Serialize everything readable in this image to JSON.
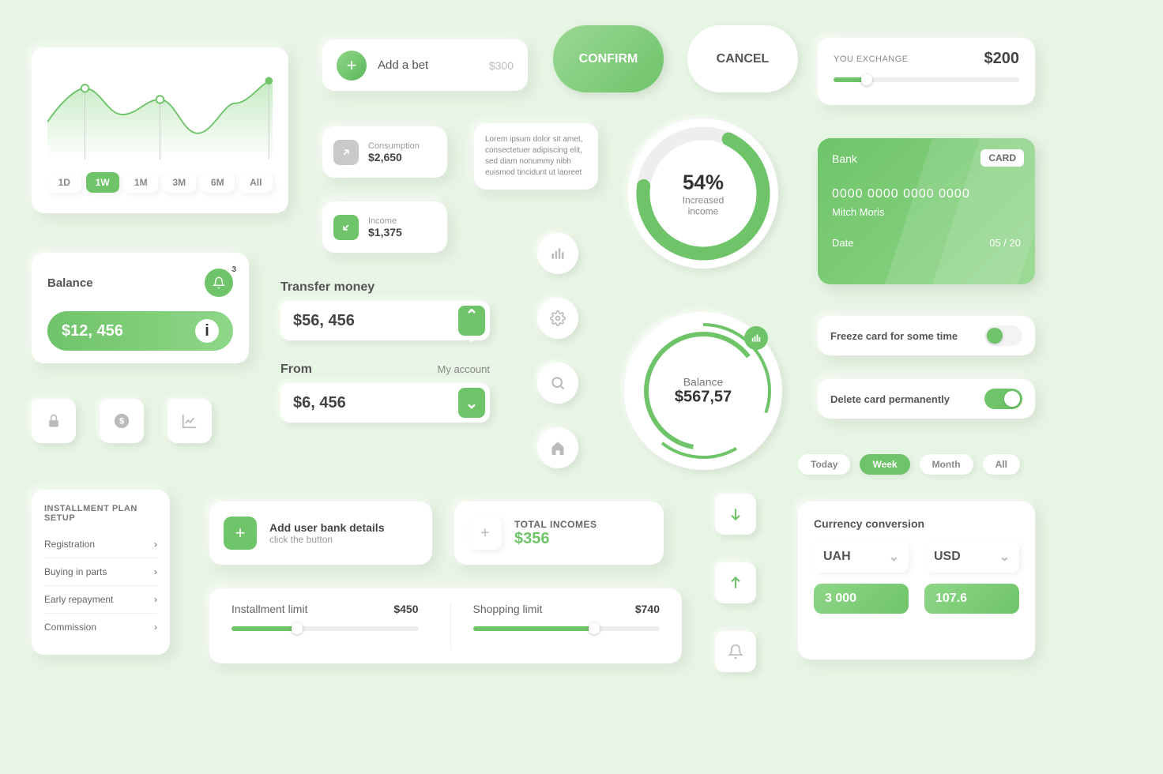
{
  "chart": {
    "tabs": [
      "1D",
      "1W",
      "1M",
      "3M",
      "6M",
      "All"
    ],
    "active": 1
  },
  "chart_data": {
    "type": "area",
    "x": [
      0,
      1,
      2,
      3,
      4,
      5,
      6
    ],
    "values": [
      50,
      85,
      55,
      70,
      35,
      70,
      95
    ],
    "ylim": [
      0,
      100
    ],
    "markers": [
      1,
      3,
      6
    ],
    "title": "",
    "xlabel": "",
    "ylabel": ""
  },
  "bet": {
    "add_label": "Add a bet",
    "amount": "$300"
  },
  "confirm_label": "CONFIRM",
  "cancel_label": "CANCEL",
  "exchange": {
    "title": "YOU EXCHANGE",
    "value": "$200",
    "pct": 18
  },
  "consumption": {
    "label": "Consumption",
    "value": "$2,650"
  },
  "income": {
    "label": "Income",
    "value": "$1,375"
  },
  "lorem": "Lorem ipsum dolor sit amet, consectetuer adipiscing elit, sed diam nonummy nibh euismod tincidunt ut laoreet",
  "donut1": {
    "pct": "54%",
    "label1": "Increased",
    "label2": "income",
    "progress": 70
  },
  "bank_card": {
    "brand": "Bank",
    "badge": "CARD",
    "number": "0000 0000 0000 0000",
    "holder": "Mitch Moris",
    "date_label": "Date",
    "date": "05 / 20"
  },
  "balance_card": {
    "title": "Balance",
    "value": "$12, 456",
    "notif": "3"
  },
  "transfer": {
    "title": "Transfer money",
    "amount": "$56, 456"
  },
  "from": {
    "title": "From",
    "sub": "My account",
    "amount": "$6, 456"
  },
  "donut2": {
    "title": "Balance",
    "value": "$567,57"
  },
  "toggle1_label": "Freeze card for some time",
  "toggle2_label": "Delete card permanently",
  "time_pills": [
    "Today",
    "Week",
    "Month",
    "All"
  ],
  "time_active": 1,
  "install": {
    "title": "INSTALLMENT PLAN SETUP",
    "items": [
      "Registration",
      "Buying in parts",
      "Early repayment",
      "Commission"
    ]
  },
  "add_user": {
    "title": "Add user bank details",
    "sub": "click the button"
  },
  "total_incomes": {
    "title": "TOTAL INCOMES",
    "value": "$356"
  },
  "limits": {
    "installment": {
      "label": "Installment limit",
      "value": "$450",
      "pct": 35
    },
    "shopping": {
      "label": "Shopping limit",
      "value": "$740",
      "pct": 65
    }
  },
  "currency": {
    "title": "Currency conversion",
    "from": "UAH",
    "to": "USD",
    "from_val": "3 000",
    "to_val": "107.6"
  }
}
